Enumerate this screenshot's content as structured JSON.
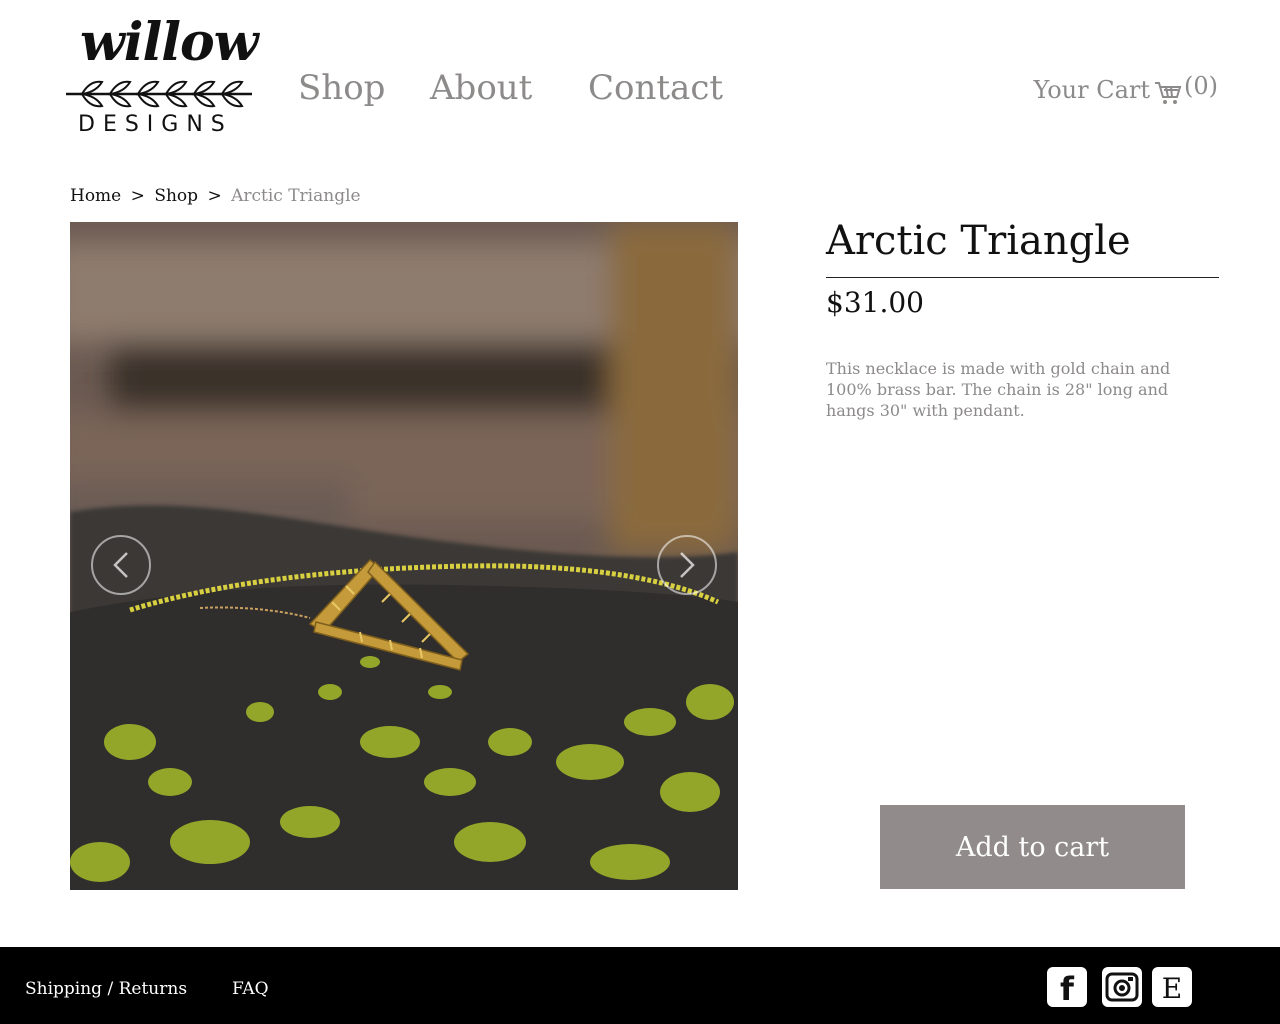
{
  "brand": {
    "logo_word": "willow",
    "logo_sub": "DESIGNS"
  },
  "nav": {
    "shop": "Shop",
    "about": "About",
    "contact": "Contact"
  },
  "cart": {
    "label": "Your Cart",
    "count": "(0)"
  },
  "breadcrumb": {
    "home": "Home",
    "sep": ">",
    "shop": "Shop",
    "current": "Arctic Triangle"
  },
  "product": {
    "title": "Arctic Triangle",
    "price": "$31.00",
    "description": "This necklace is made with gold chain and 100% brass bar. The chain is 28\" long and hangs 30\" with pendant.",
    "add_to_cart": "Add to cart"
  },
  "footer": {
    "shipping": "Shipping / Returns",
    "faq": "FAQ",
    "social": [
      {
        "name": "facebook-icon",
        "glyph": "f"
      },
      {
        "name": "instagram-icon",
        "glyph": ""
      },
      {
        "name": "etsy-icon",
        "glyph": "E"
      }
    ]
  },
  "colors": {
    "muted_text": "#8d8a8a",
    "button": "#918b8b",
    "footer_bg": "#000000"
  }
}
